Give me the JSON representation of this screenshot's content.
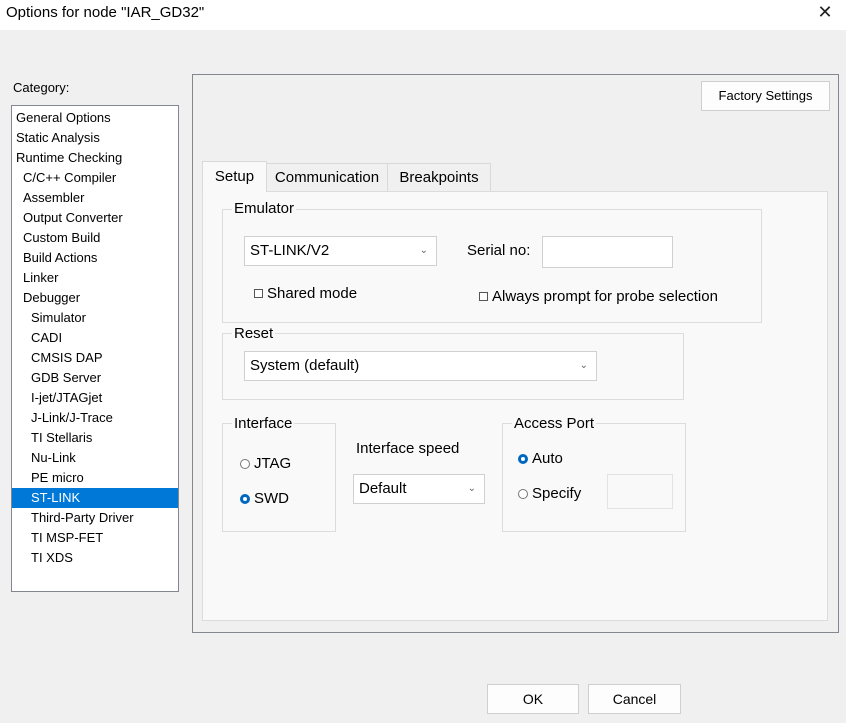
{
  "window": {
    "title": "Options for node \"IAR_GD32\""
  },
  "category": {
    "label": "Category:",
    "items": [
      {
        "label": "General Options",
        "indent": 0
      },
      {
        "label": "Static Analysis",
        "indent": 0
      },
      {
        "label": "Runtime Checking",
        "indent": 0
      },
      {
        "label": "C/C++ Compiler",
        "indent": 1
      },
      {
        "label": "Assembler",
        "indent": 1
      },
      {
        "label": "Output Converter",
        "indent": 1
      },
      {
        "label": "Custom Build",
        "indent": 1
      },
      {
        "label": "Build Actions",
        "indent": 1
      },
      {
        "label": "Linker",
        "indent": 1
      },
      {
        "label": "Debugger",
        "indent": 1
      },
      {
        "label": "Simulator",
        "indent": 2
      },
      {
        "label": "CADI",
        "indent": 2
      },
      {
        "label": "CMSIS DAP",
        "indent": 2
      },
      {
        "label": "GDB Server",
        "indent": 2
      },
      {
        "label": "I-jet/JTAGjet",
        "indent": 2
      },
      {
        "label": "J-Link/J-Trace",
        "indent": 2
      },
      {
        "label": "TI Stellaris",
        "indent": 2
      },
      {
        "label": "Nu-Link",
        "indent": 2
      },
      {
        "label": "PE micro",
        "indent": 2
      },
      {
        "label": "ST-LINK",
        "indent": 2,
        "selected": true
      },
      {
        "label": "Third-Party Driver",
        "indent": 2
      },
      {
        "label": "TI MSP-FET",
        "indent": 2
      },
      {
        "label": "TI XDS",
        "indent": 2
      }
    ]
  },
  "factory_settings_label": "Factory Settings",
  "tabs": [
    {
      "label": "Setup",
      "active": true
    },
    {
      "label": "Communication",
      "active": false
    },
    {
      "label": "Breakpoints",
      "active": false
    }
  ],
  "emulator": {
    "group_label": "Emulator",
    "selected": "ST-LINK/V2",
    "serial_label": "Serial no:",
    "serial_value": "",
    "shared_mode_label": "Shared mode",
    "shared_mode_checked": false,
    "always_prompt_label": "Always prompt for probe selection",
    "always_prompt_checked": false
  },
  "reset": {
    "group_label": "Reset",
    "selected": "System (default)"
  },
  "interface": {
    "group_label": "Interface",
    "options": [
      {
        "label": "JTAG",
        "checked": false
      },
      {
        "label": "SWD",
        "checked": true
      }
    ]
  },
  "interface_speed": {
    "label": "Interface speed",
    "selected": "Default"
  },
  "access_port": {
    "group_label": "Access Port",
    "auto_label": "Auto",
    "auto_checked": true,
    "specify_label": "Specify",
    "specify_checked": false,
    "specify_value": ""
  },
  "buttons": {
    "ok": "OK",
    "cancel": "Cancel"
  },
  "colors": {
    "selection": "#0078d7",
    "radio_accent": "#0067c0"
  },
  "icons": {
    "close": "close-icon",
    "dropdown": "chevron-down-icon"
  }
}
